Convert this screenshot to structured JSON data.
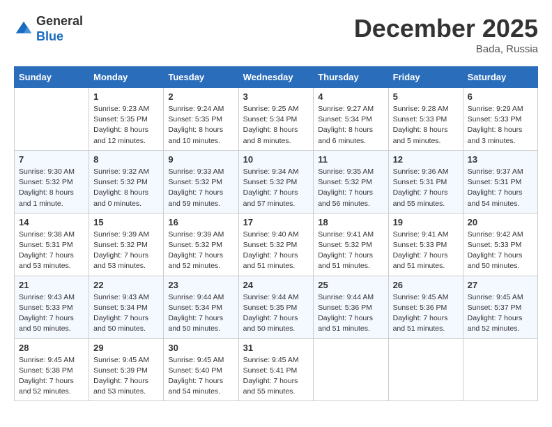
{
  "header": {
    "logo_general": "General",
    "logo_blue": "Blue",
    "month": "December 2025",
    "location": "Bada, Russia"
  },
  "weekdays": [
    "Sunday",
    "Monday",
    "Tuesday",
    "Wednesday",
    "Thursday",
    "Friday",
    "Saturday"
  ],
  "weeks": [
    [
      {
        "day": "",
        "info": ""
      },
      {
        "day": "1",
        "info": "Sunrise: 9:23 AM\nSunset: 5:35 PM\nDaylight: 8 hours\nand 12 minutes."
      },
      {
        "day": "2",
        "info": "Sunrise: 9:24 AM\nSunset: 5:35 PM\nDaylight: 8 hours\nand 10 minutes."
      },
      {
        "day": "3",
        "info": "Sunrise: 9:25 AM\nSunset: 5:34 PM\nDaylight: 8 hours\nand 8 minutes."
      },
      {
        "day": "4",
        "info": "Sunrise: 9:27 AM\nSunset: 5:34 PM\nDaylight: 8 hours\nand 6 minutes."
      },
      {
        "day": "5",
        "info": "Sunrise: 9:28 AM\nSunset: 5:33 PM\nDaylight: 8 hours\nand 5 minutes."
      },
      {
        "day": "6",
        "info": "Sunrise: 9:29 AM\nSunset: 5:33 PM\nDaylight: 8 hours\nand 3 minutes."
      }
    ],
    [
      {
        "day": "7",
        "info": "Sunrise: 9:30 AM\nSunset: 5:32 PM\nDaylight: 8 hours\nand 1 minute."
      },
      {
        "day": "8",
        "info": "Sunrise: 9:32 AM\nSunset: 5:32 PM\nDaylight: 8 hours\nand 0 minutes."
      },
      {
        "day": "9",
        "info": "Sunrise: 9:33 AM\nSunset: 5:32 PM\nDaylight: 7 hours\nand 59 minutes."
      },
      {
        "day": "10",
        "info": "Sunrise: 9:34 AM\nSunset: 5:32 PM\nDaylight: 7 hours\nand 57 minutes."
      },
      {
        "day": "11",
        "info": "Sunrise: 9:35 AM\nSunset: 5:32 PM\nDaylight: 7 hours\nand 56 minutes."
      },
      {
        "day": "12",
        "info": "Sunrise: 9:36 AM\nSunset: 5:31 PM\nDaylight: 7 hours\nand 55 minutes."
      },
      {
        "day": "13",
        "info": "Sunrise: 9:37 AM\nSunset: 5:31 PM\nDaylight: 7 hours\nand 54 minutes."
      }
    ],
    [
      {
        "day": "14",
        "info": "Sunrise: 9:38 AM\nSunset: 5:31 PM\nDaylight: 7 hours\nand 53 minutes."
      },
      {
        "day": "15",
        "info": "Sunrise: 9:39 AM\nSunset: 5:32 PM\nDaylight: 7 hours\nand 53 minutes."
      },
      {
        "day": "16",
        "info": "Sunrise: 9:39 AM\nSunset: 5:32 PM\nDaylight: 7 hours\nand 52 minutes."
      },
      {
        "day": "17",
        "info": "Sunrise: 9:40 AM\nSunset: 5:32 PM\nDaylight: 7 hours\nand 51 minutes."
      },
      {
        "day": "18",
        "info": "Sunrise: 9:41 AM\nSunset: 5:32 PM\nDaylight: 7 hours\nand 51 minutes."
      },
      {
        "day": "19",
        "info": "Sunrise: 9:41 AM\nSunset: 5:33 PM\nDaylight: 7 hours\nand 51 minutes."
      },
      {
        "day": "20",
        "info": "Sunrise: 9:42 AM\nSunset: 5:33 PM\nDaylight: 7 hours\nand 50 minutes."
      }
    ],
    [
      {
        "day": "21",
        "info": "Sunrise: 9:43 AM\nSunset: 5:33 PM\nDaylight: 7 hours\nand 50 minutes."
      },
      {
        "day": "22",
        "info": "Sunrise: 9:43 AM\nSunset: 5:34 PM\nDaylight: 7 hours\nand 50 minutes."
      },
      {
        "day": "23",
        "info": "Sunrise: 9:44 AM\nSunset: 5:34 PM\nDaylight: 7 hours\nand 50 minutes."
      },
      {
        "day": "24",
        "info": "Sunrise: 9:44 AM\nSunset: 5:35 PM\nDaylight: 7 hours\nand 50 minutes."
      },
      {
        "day": "25",
        "info": "Sunrise: 9:44 AM\nSunset: 5:36 PM\nDaylight: 7 hours\nand 51 minutes."
      },
      {
        "day": "26",
        "info": "Sunrise: 9:45 AM\nSunset: 5:36 PM\nDaylight: 7 hours\nand 51 minutes."
      },
      {
        "day": "27",
        "info": "Sunrise: 9:45 AM\nSunset: 5:37 PM\nDaylight: 7 hours\nand 52 minutes."
      }
    ],
    [
      {
        "day": "28",
        "info": "Sunrise: 9:45 AM\nSunset: 5:38 PM\nDaylight: 7 hours\nand 52 minutes."
      },
      {
        "day": "29",
        "info": "Sunrise: 9:45 AM\nSunset: 5:39 PM\nDaylight: 7 hours\nand 53 minutes."
      },
      {
        "day": "30",
        "info": "Sunrise: 9:45 AM\nSunset: 5:40 PM\nDaylight: 7 hours\nand 54 minutes."
      },
      {
        "day": "31",
        "info": "Sunrise: 9:45 AM\nSunset: 5:41 PM\nDaylight: 7 hours\nand 55 minutes."
      },
      {
        "day": "",
        "info": ""
      },
      {
        "day": "",
        "info": ""
      },
      {
        "day": "",
        "info": ""
      }
    ]
  ]
}
